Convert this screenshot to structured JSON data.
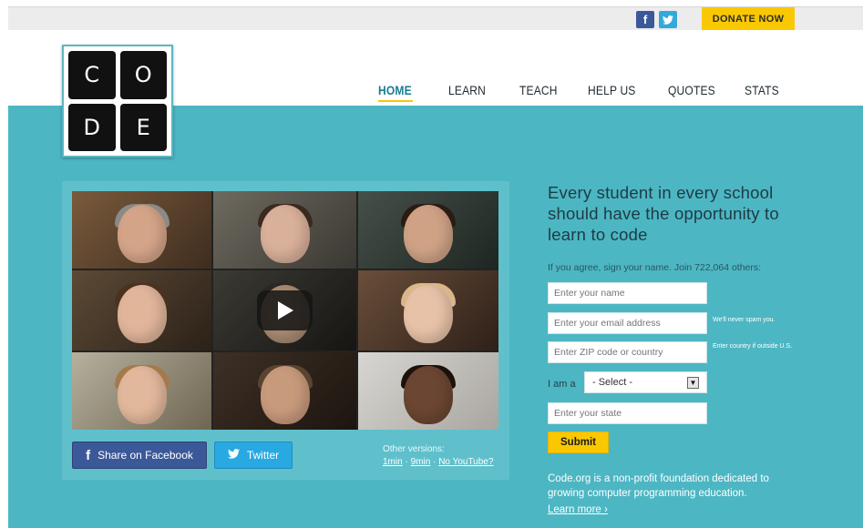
{
  "colors": {
    "teal": "#4db6c3",
    "yellow": "#f9c800",
    "facebook": "#3b5998",
    "twitter": "#29a9e1"
  },
  "topbar": {
    "facebook_icon": "f",
    "twitter_icon": "bird",
    "donate_label": "DONATE NOW"
  },
  "logo": {
    "letters": [
      "C",
      "O",
      "D",
      "E"
    ]
  },
  "nav": {
    "items": [
      {
        "label": "HOME",
        "active": true
      },
      {
        "label": "LEARN",
        "active": false
      },
      {
        "label": "TEACH",
        "active": false
      },
      {
        "label": "HELP US",
        "active": false
      },
      {
        "label": "QUOTES",
        "active": false
      },
      {
        "label": "STATS",
        "active": false
      }
    ]
  },
  "video": {
    "play_icon": "play-icon",
    "share_facebook": "Share on Facebook",
    "share_twitter": "Twitter",
    "other_versions_label": "Other versions:",
    "version_links": [
      "1min",
      "9min",
      "No YouTube?"
    ],
    "link_separator": "·"
  },
  "signup": {
    "headline": "Every student in every school should have the opportunity to learn to code",
    "sign_line": "If you agree, sign your name. Join 722,064 others:",
    "name_placeholder": "Enter your name",
    "email_placeholder": "Enter your email address",
    "email_hint": "We'll never spam you.",
    "zip_placeholder": "Enter ZIP code or country",
    "zip_hint": "Enter country if outside U.S.",
    "iam_label": "I am a",
    "select_value": "- Select -",
    "state_placeholder": "Enter your state",
    "submit_label": "Submit",
    "about_text": "Code.org is a non-profit foundation dedicated to growing computer programming education.",
    "learn_more": "Learn more ›"
  }
}
